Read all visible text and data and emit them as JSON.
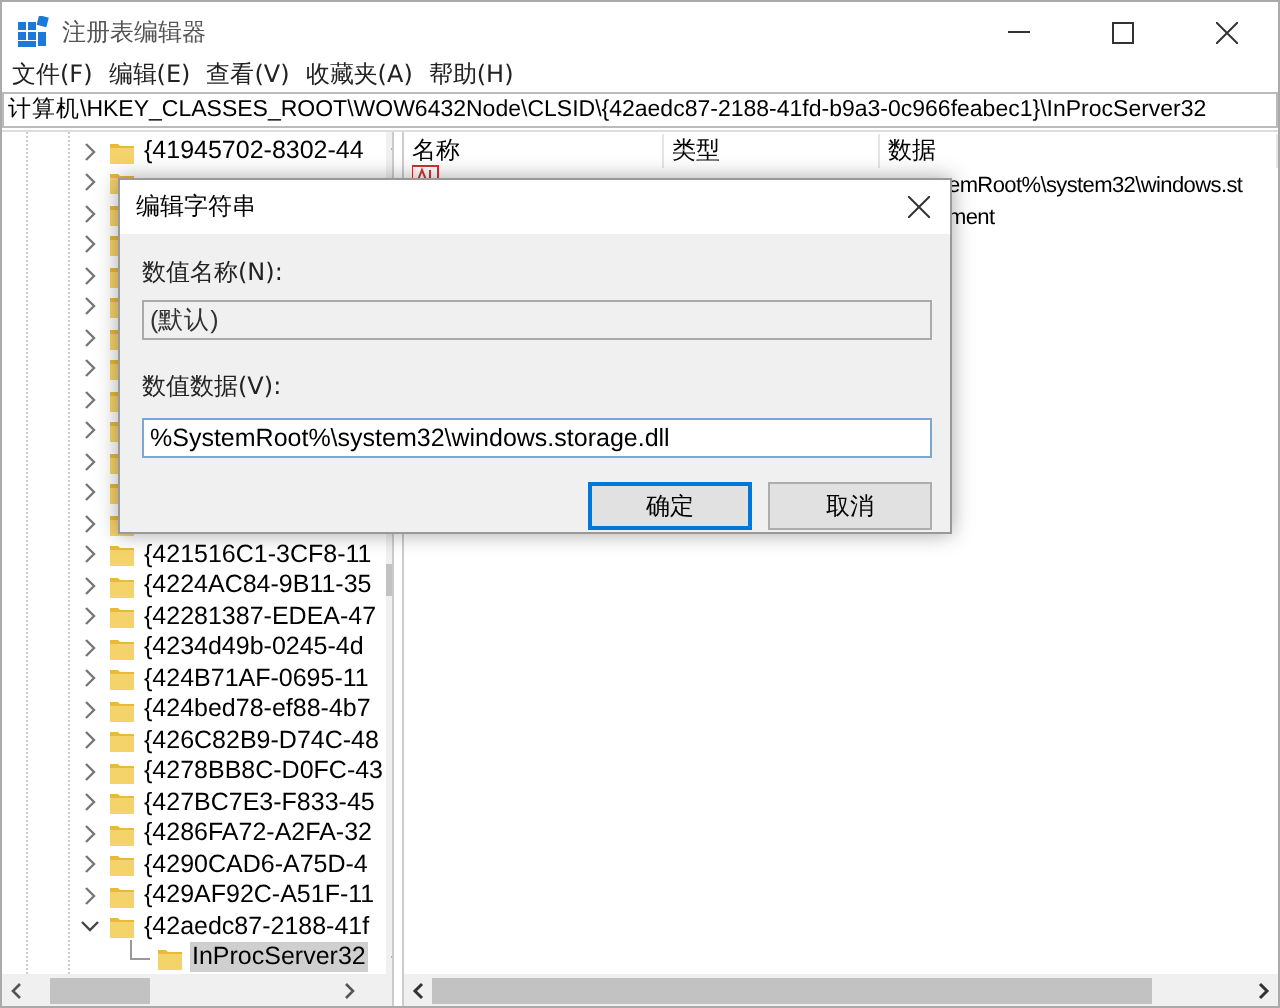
{
  "window": {
    "title": "注册表编辑器"
  },
  "menu": [
    "文件(F)",
    "编辑(E)",
    "查看(V)",
    "收藏夹(A)",
    "帮助(H)"
  ],
  "address": "计算机\\HKEY_CLASSES_ROOT\\WOW6432Node\\CLSID\\{42aedc87-2188-41fd-b9a3-0c966feabec1}\\InProcServer32",
  "tree": {
    "items": [
      {
        "label": "{41945702-8302-44",
        "expanded": false,
        "selected": false
      },
      {
        "expanded": false
      },
      {
        "expanded": false
      },
      {
        "expanded": false
      },
      {
        "expanded": false
      },
      {
        "expanded": false
      },
      {
        "expanded": false
      },
      {
        "expanded": false
      },
      {
        "expanded": false
      },
      {
        "expanded": false
      },
      {
        "expanded": false
      },
      {
        "expanded": false
      },
      {
        "expanded": false
      },
      {
        "label": "{421516C1-3CF8-11",
        "expanded": false,
        "selected": false
      },
      {
        "label": "{4224AC84-9B11-35",
        "expanded": false,
        "selected": false
      },
      {
        "label": "{42281387-EDEA-47",
        "expanded": false,
        "selected": false
      },
      {
        "label": "{4234d49b-0245-4d",
        "expanded": false,
        "selected": false
      },
      {
        "label": "{424B71AF-0695-11",
        "expanded": false,
        "selected": false
      },
      {
        "label": "{424bed78-ef88-4b7",
        "expanded": false,
        "selected": false
      },
      {
        "label": "{426C82B9-D74C-48",
        "expanded": false,
        "selected": false
      },
      {
        "label": "{4278BB8C-D0FC-43",
        "expanded": false,
        "selected": false
      },
      {
        "label": "{427BC7E3-F833-45",
        "expanded": false,
        "selected": false
      },
      {
        "label": "{4286FA72-A2FA-32",
        "expanded": false,
        "selected": false
      },
      {
        "label": "{4290CAD6-A75D-4",
        "expanded": false,
        "selected": false
      },
      {
        "label": "{429AF92C-A51F-11",
        "expanded": false,
        "selected": false
      },
      {
        "label": "{42aedc87-2188-41f",
        "expanded": true,
        "selected": false,
        "children": [
          {
            "label": "InProcServer32",
            "selected": true
          }
        ]
      }
    ]
  },
  "values": {
    "columns": [
      "名称",
      "类型",
      "数据"
    ],
    "rows": [
      {
        "data": "emRoot%\\system32\\windows.st"
      },
      {
        "data": "ment"
      }
    ]
  },
  "dialog": {
    "title": "编辑字符串",
    "name_label": "数值名称(N):",
    "name_value": "(默认)",
    "name_disabled": true,
    "data_label": "数值数据(V):",
    "data_value": "%SystemRoot%\\system32\\windows.storage.dll",
    "buttons": [
      {
        "label": "确定",
        "default": true
      },
      {
        "label": "取消",
        "default": false
      }
    ]
  }
}
